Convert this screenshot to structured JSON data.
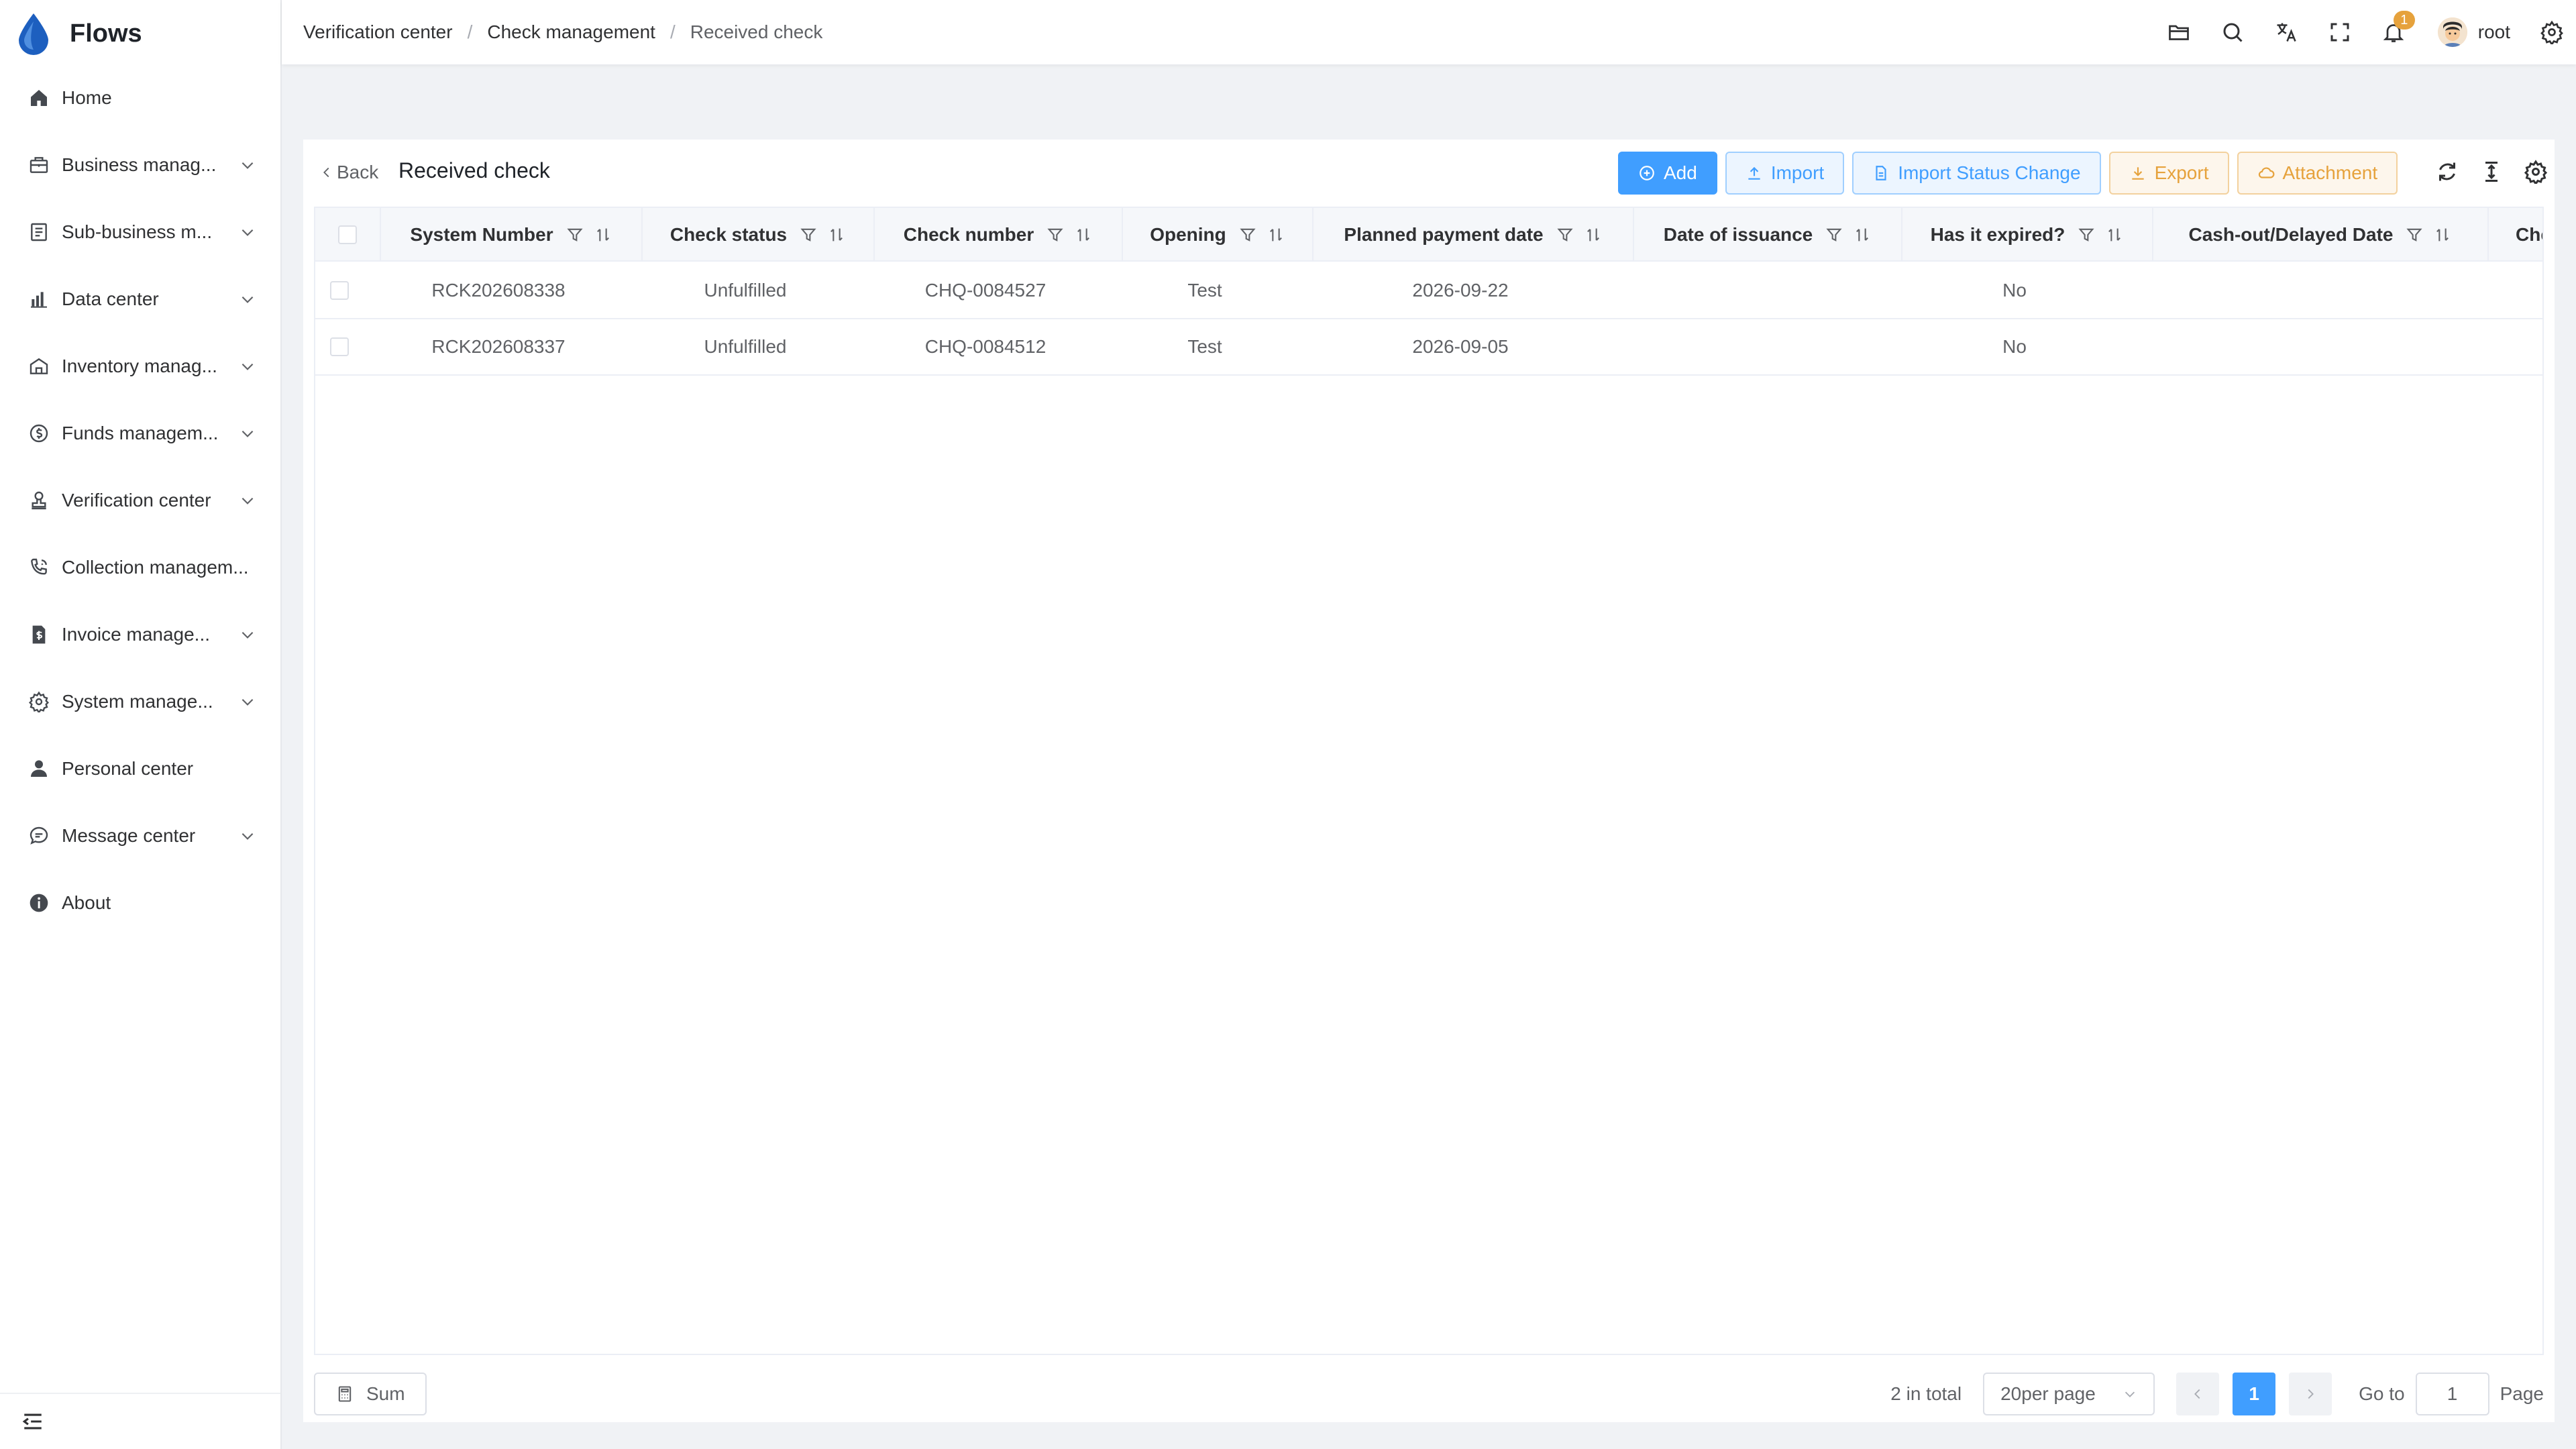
{
  "app": {
    "title": "Flows"
  },
  "sidebar": {
    "items": [
      {
        "label": "Home",
        "icon": "home-icon",
        "expandable": false
      },
      {
        "label": "Business manag...",
        "icon": "briefcase-icon",
        "expandable": true
      },
      {
        "label": "Sub-business m...",
        "icon": "document-list-icon",
        "expandable": true
      },
      {
        "label": "Data center",
        "icon": "bar-chart-icon",
        "expandable": true
      },
      {
        "label": "Inventory manag...",
        "icon": "warehouse-icon",
        "expandable": true
      },
      {
        "label": "Funds managem...",
        "icon": "coin-icon",
        "expandable": true
      },
      {
        "label": "Verification center",
        "icon": "stamp-icon",
        "expandable": true
      },
      {
        "label": "Collection managem...",
        "icon": "phone-call-icon",
        "expandable": false
      },
      {
        "label": "Invoice manage...",
        "icon": "invoice-icon",
        "expandable": true
      },
      {
        "label": "System manage...",
        "icon": "gear-icon",
        "expandable": true
      },
      {
        "label": "Personal center",
        "icon": "user-icon",
        "expandable": false
      },
      {
        "label": "Message center",
        "icon": "chat-icon",
        "expandable": true
      },
      {
        "label": "About",
        "icon": "info-icon",
        "expandable": false
      }
    ]
  },
  "header": {
    "breadcrumb": [
      "Verification center",
      "Check management",
      "Received check"
    ],
    "notification_count": "1",
    "user_name": "root"
  },
  "page": {
    "back_label": "Back",
    "title": "Received check",
    "buttons": {
      "add": "Add",
      "import": "Import",
      "import_status": "Import Status Change",
      "export": "Export",
      "attachment": "Attachment"
    }
  },
  "table": {
    "columns": [
      "System Number",
      "Check status",
      "Check number",
      "Opening",
      "Planned payment date",
      "Date of issuance",
      "Has it expired?",
      "Cash-out/Delayed Date",
      "Che"
    ],
    "rows": [
      {
        "system_number": "RCK202608338",
        "check_status": "Unfulfilled",
        "check_number": "CHQ-0084527",
        "opening": "Test",
        "planned_payment_date": "2026-09-22",
        "date_of_issuance": "",
        "has_expired": "No",
        "cashout_date": ""
      },
      {
        "system_number": "RCK202608337",
        "check_status": "Unfulfilled",
        "check_number": "CHQ-0084512",
        "opening": "Test",
        "planned_payment_date": "2026-09-05",
        "date_of_issuance": "",
        "has_expired": "No",
        "cashout_date": ""
      }
    ]
  },
  "footer": {
    "sum_label": "Sum",
    "total_text": "2 in total",
    "page_size": "20per page",
    "current_page": "1",
    "goto_label": "Go to",
    "goto_value": "1",
    "page_suffix": "Page"
  },
  "colors": {
    "primary": "#409eff",
    "warning": "#e6a23c",
    "logo_drop": "#1d5fbf"
  }
}
